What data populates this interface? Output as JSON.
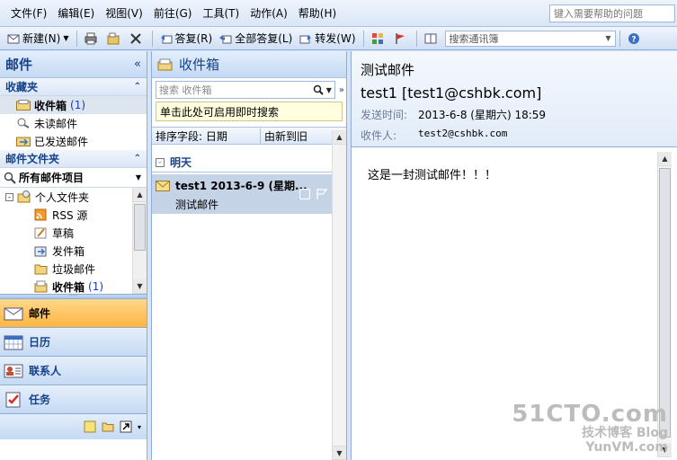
{
  "menu": {
    "items": [
      "文件(F)",
      "编辑(E)",
      "视图(V)",
      "前往(G)",
      "工具(T)",
      "动作(A)",
      "帮助(H)"
    ],
    "help_placeholder": "键入需要帮助的问题"
  },
  "toolbar": {
    "new_label": "新建(N)",
    "reply_label": "答复(R)",
    "reply_all_label": "全部答复(L)",
    "forward_label": "转发(W)",
    "address_search_placeholder": "搜索通讯簿"
  },
  "nav": {
    "title": "邮件",
    "favorites_header": "收藏夹",
    "favorites": [
      {
        "label": "收件箱",
        "count": "(1)",
        "selected": true
      },
      {
        "label": "未读邮件",
        "count": ""
      },
      {
        "label": "已发送邮件",
        "count": ""
      }
    ],
    "folders_header": "邮件文件夹",
    "all_items_label": "所有邮件项目",
    "tree": [
      {
        "label": "个人文件夹",
        "count": "",
        "indent": 0
      },
      {
        "label": "RSS 源",
        "count": "",
        "indent": 1
      },
      {
        "label": "草稿",
        "count": "",
        "indent": 1
      },
      {
        "label": "发件箱",
        "count": "",
        "indent": 1
      },
      {
        "label": "垃圾邮件",
        "count": "",
        "indent": 1
      },
      {
        "label": "收件箱",
        "count": "(1)",
        "indent": 1
      }
    ],
    "buttons": [
      {
        "label": "邮件",
        "icon": "mail-icon",
        "active": true
      },
      {
        "label": "日历",
        "icon": "calendar-icon",
        "active": false
      },
      {
        "label": "联系人",
        "icon": "contacts-icon",
        "active": false
      },
      {
        "label": "任务",
        "icon": "tasks-icon",
        "active": false
      }
    ]
  },
  "list": {
    "title": "收件箱",
    "search_placeholder": "搜索 收件箱",
    "instant_search_hint": "单击此处可启用即时搜索",
    "arrange_label": "排序字段: 日期",
    "order_label": "由新到旧",
    "group_label": "明天",
    "group_toggle": "-",
    "mail": {
      "sender_date": "test1  2013-6-9 (星期...",
      "subject": "测试邮件"
    }
  },
  "reading": {
    "subject": "测试邮件",
    "from": "test1 [test1@cshbk.com]",
    "sent_label": "发送时间:",
    "sent_value": "2013-6-8 (星期六) 18:59",
    "to_label": "收件人:",
    "to_value": "test2@cshbk.com",
    "body": "这是一封测试邮件！！！"
  },
  "watermark": {
    "line1": "51CTO.com",
    "line2": "技术博客  Blog",
    "line3": "YunVM.com"
  }
}
